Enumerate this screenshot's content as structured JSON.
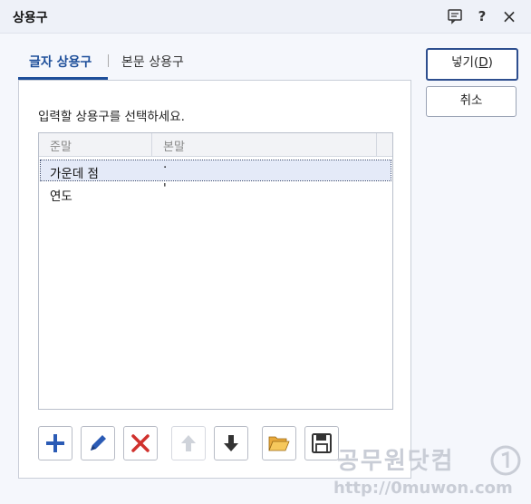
{
  "window": {
    "title": "상용구",
    "icons": [
      "comment-icon",
      "help-icon",
      "close-icon"
    ],
    "help_glyph": "?",
    "close_glyph": "×"
  },
  "tabs": [
    {
      "label": "글자 상용구",
      "active": true
    },
    {
      "label": "본문 상용구",
      "active": false
    }
  ],
  "instruction": "입력할 상용구를 선택하세요.",
  "list": {
    "columns": [
      "준말",
      "본말"
    ],
    "rows": [
      {
        "short": "가운데 점",
        "full": "·",
        "selected": true
      },
      {
        "short": "연도",
        "full": "'",
        "selected": false
      }
    ]
  },
  "toolbar": {
    "buttons": [
      {
        "name": "add-icon",
        "enabled": true
      },
      {
        "name": "edit-pencil-icon",
        "enabled": true
      },
      {
        "name": "delete-x-icon",
        "enabled": true
      },
      {
        "name": "move-up-arrow-icon",
        "enabled": false
      },
      {
        "name": "move-down-arrow-icon",
        "enabled": true
      },
      {
        "name": "open-folder-icon",
        "enabled": true
      },
      {
        "name": "save-disk-icon",
        "enabled": true
      }
    ]
  },
  "actions": {
    "insert_prefix": "넣기(",
    "insert_key": "D",
    "insert_suffix": ")",
    "cancel": "취소"
  },
  "watermark": {
    "text": "공무원닷컴",
    "url": "http://0muwon.com"
  },
  "colors": {
    "accent": "#1d4e9a",
    "add_icon": "#2b5bb5",
    "delete_icon": "#d0312d"
  }
}
